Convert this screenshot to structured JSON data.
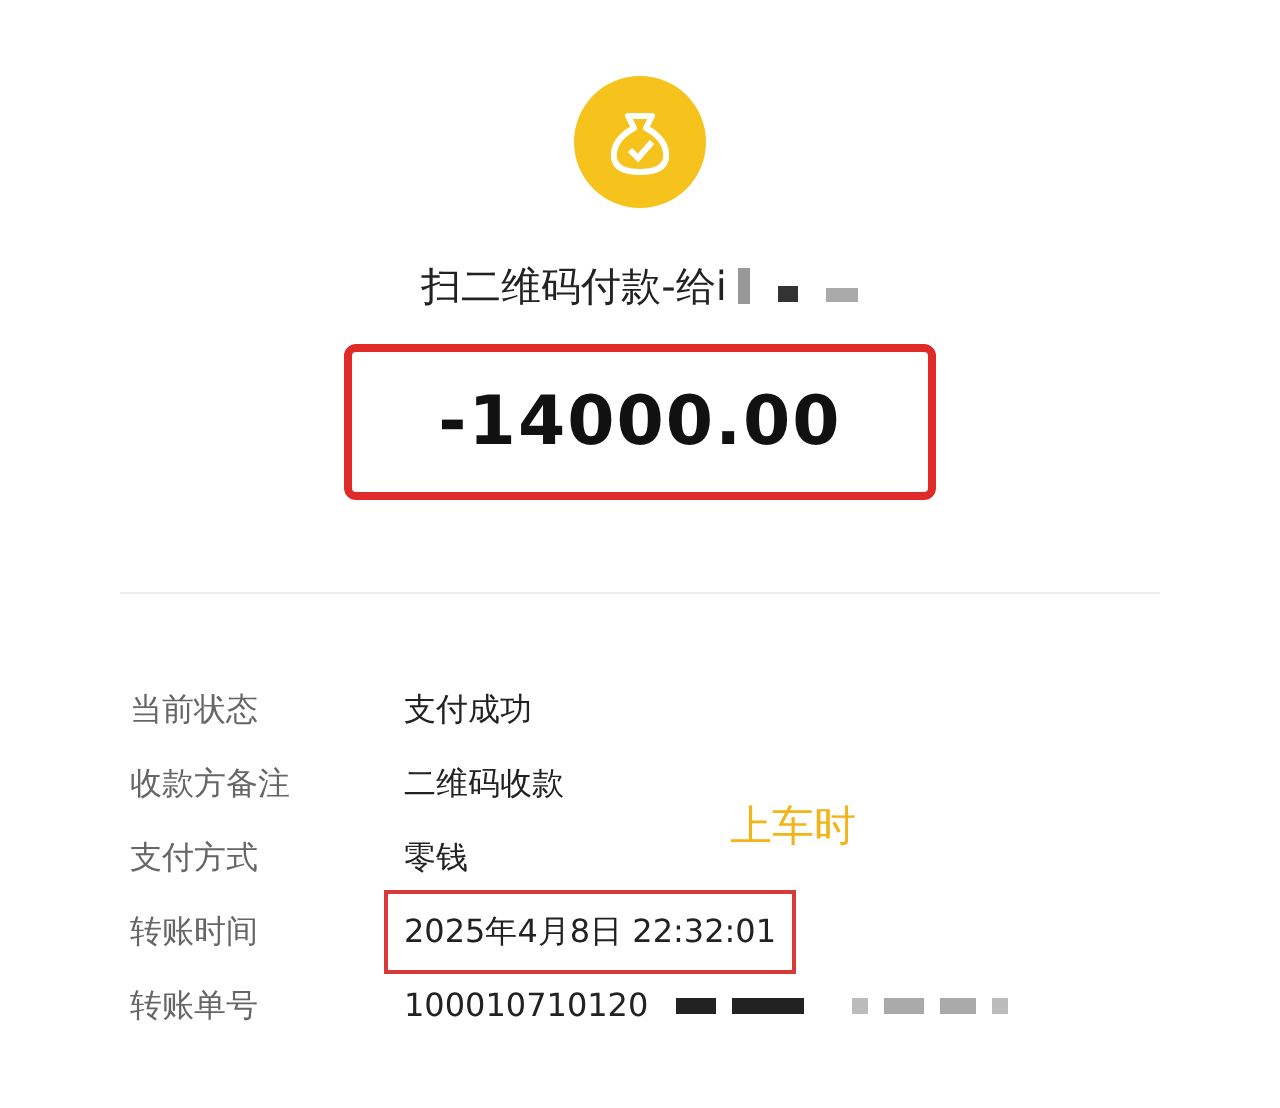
{
  "header": {
    "title": "扫二维码付款-给i",
    "amount": "-14000.00",
    "amount_highlighted": true
  },
  "details": [
    {
      "label": "当前状态",
      "value": "支付成功",
      "highlighted": false
    },
    {
      "label": "收款方备注",
      "value": "二维码收款",
      "highlighted": false
    },
    {
      "label": "支付方式",
      "value": "零钱",
      "highlighted": false
    },
    {
      "label": "转账时间",
      "value": "2025年4月8日 22:32:01",
      "highlighted": true
    },
    {
      "label": "转账单号",
      "value": "100010710120",
      "highlighted": false
    }
  ],
  "annotation": "上车时"
}
